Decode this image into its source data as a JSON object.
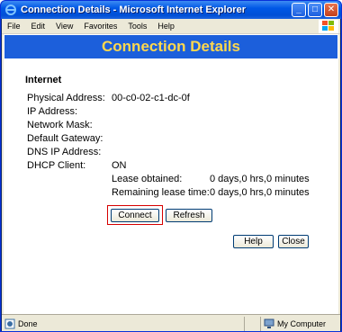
{
  "window": {
    "title": "Connection Details - Microsoft Internet Explorer",
    "minimize_label": "_",
    "maximize_label": "□",
    "close_label": "✕"
  },
  "menubar": {
    "items": [
      "File",
      "Edit",
      "View",
      "Favorites",
      "Tools",
      "Help"
    ]
  },
  "page": {
    "banner_title": "Connection Details",
    "section_title": "Internet",
    "fields": [
      {
        "label": "Physical Address:",
        "value": "00-c0-02-c1-dc-0f"
      },
      {
        "label": "IP Address:",
        "value": ""
      },
      {
        "label": "Network Mask:",
        "value": ""
      },
      {
        "label": "Default Gateway:",
        "value": ""
      },
      {
        "label": "DNS IP Address:",
        "value": ""
      },
      {
        "label": "DHCP Client:",
        "value": "ON"
      }
    ],
    "lease": [
      {
        "label": "Lease obtained:",
        "value": "0 days,0 hrs,0 minutes"
      },
      {
        "label": "Remaining lease time:",
        "value": "0 days,0 hrs,0 minutes"
      }
    ],
    "buttons": {
      "connect": "Connect",
      "refresh": "Refresh",
      "help": "Help",
      "close": "Close"
    }
  },
  "statusbar": {
    "status": "Done",
    "zone": "My Computer"
  },
  "colors": {
    "banner_bg": "#1c5fdb",
    "banner_text": "#ffd84d",
    "highlight": "#d60000"
  }
}
